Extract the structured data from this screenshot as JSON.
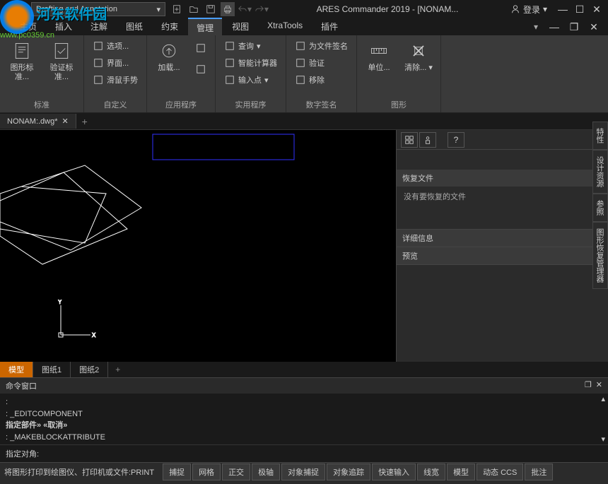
{
  "watermark": {
    "text": "河东软件园",
    "url": "www.pc0359.cn"
  },
  "titlebar": {
    "workspace": "Drafting and Annotation",
    "title": "ARES Commander 2019 - [NONAM...",
    "login": "登录"
  },
  "menu": {
    "tabs": [
      "主页",
      "插入",
      "注解",
      "图纸",
      "约束",
      "管理",
      "视图",
      "XtraTools",
      "插件"
    ],
    "active": 5
  },
  "ribbon": {
    "groups": [
      {
        "label": "标准",
        "big": [
          {
            "label": "图形标准...",
            "icon": "standards"
          },
          {
            "label": "验证标准...",
            "icon": "verify"
          }
        ]
      },
      {
        "label": "自定义",
        "small": [
          {
            "label": "选项...",
            "icon": "options"
          },
          {
            "label": "界面...",
            "icon": "interface"
          },
          {
            "label": "滑鼠手势",
            "icon": "mouse"
          }
        ]
      },
      {
        "label": "应用程序",
        "big": [
          {
            "label": "加载...",
            "icon": "load"
          }
        ],
        "side_icons": [
          "play-arrow",
          "add-script"
        ]
      },
      {
        "label": "实用程序",
        "small": [
          {
            "label": "查询",
            "icon": "query",
            "dropdown": true
          },
          {
            "label": "智能计算器",
            "icon": "calc"
          },
          {
            "label": "输入点",
            "icon": "point",
            "dropdown": true
          }
        ]
      },
      {
        "label": "数字签名",
        "small": [
          {
            "label": "为文件签名",
            "icon": "sign"
          },
          {
            "label": "验证",
            "icon": "verify2"
          },
          {
            "label": "移除",
            "icon": "remove"
          }
        ]
      },
      {
        "label": "图形",
        "big": [
          {
            "label": "单位...",
            "icon": "units"
          },
          {
            "label": "清除...",
            "icon": "clean",
            "dropdown": true
          }
        ]
      }
    ]
  },
  "doc_tabs": {
    "tabs": [
      "NONAM:.dwg*"
    ]
  },
  "panel": {
    "sections": [
      {
        "title": "恢复文件",
        "body": "没有要恢复的文件"
      },
      {
        "title": "详细信息",
        "body": ""
      },
      {
        "title": "预览",
        "body": ""
      }
    ]
  },
  "side_tabs": [
    "特性",
    "设计资源",
    "参照",
    "图形恢复管理器"
  ],
  "layout_tabs": {
    "tabs": [
      "模型",
      "图纸1",
      "图纸2"
    ],
    "active": 0
  },
  "cmd": {
    "title": "命令窗口",
    "history": [
      ":",
      ": _EDITCOMPONENT",
      "指定部件» «取消»",
      ": _MAKEBLOCKATTRIBUTE"
    ],
    "input": "指定对角:"
  },
  "status": {
    "hint": "将图形打印到绘图仪、打印机或文件:PRINT",
    "buttons": [
      "捕捉",
      "网格",
      "正交",
      "极轴",
      "对象捕捉",
      "对象追踪",
      "快速输入",
      "线宽",
      "模型",
      "动态 CCS",
      "批注"
    ]
  }
}
